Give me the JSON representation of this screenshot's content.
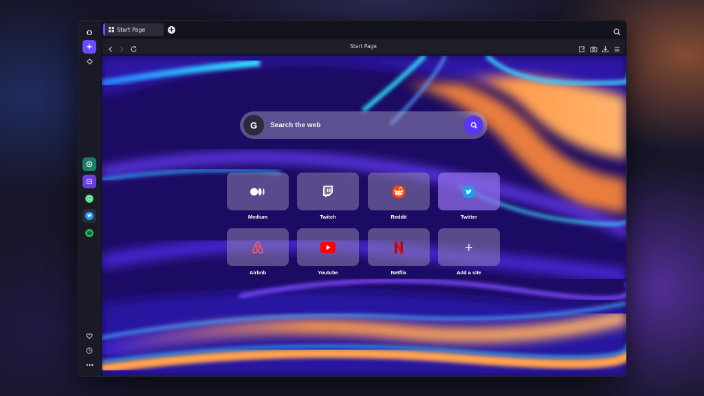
{
  "browser": {
    "logo_letter": "O",
    "tab": {
      "label": "Start Page"
    },
    "address": {
      "title": "Start Page"
    }
  },
  "sidebar": {
    "top_items": [
      "aria-ai-icon",
      "diamond-icon"
    ],
    "apps": [
      "chatgpt-icon",
      "twitch-chat-icon",
      "whatsapp-icon",
      "twitter-icon",
      "spotify-icon"
    ],
    "bottom_items": [
      "heart-icon",
      "history-icon",
      "more-icon"
    ],
    "more_label": "•••"
  },
  "toolbar": [
    "edit-icon",
    "camera-icon",
    "download-icon",
    "menu-icon"
  ],
  "search": {
    "placeholder": "Search the web",
    "engine_letter": "G"
  },
  "speed_dial": [
    {
      "label": "Medium",
      "icon": "medium-icon"
    },
    {
      "label": "Twitch",
      "icon": "twitch-icon"
    },
    {
      "label": "Reddit",
      "icon": "reddit-icon"
    },
    {
      "label": "Twitter",
      "icon": "twitter-icon"
    },
    {
      "label": "Airbnb",
      "icon": "airbnb-icon"
    },
    {
      "label": "Youtube",
      "icon": "youtube-icon"
    },
    {
      "label": "Netflix",
      "icon": "netflix-icon"
    },
    {
      "label": "Add a site",
      "icon": "plus-icon"
    }
  ],
  "colors": {
    "accent": "#5b35f5",
    "twitter": "#1d9bf0",
    "reddit": "#ff4500",
    "youtube": "#ff0000",
    "netflix": "#e50914",
    "airbnb": "#ff5a5f",
    "whatsapp": "#25d366",
    "spotify": "#1db954"
  }
}
